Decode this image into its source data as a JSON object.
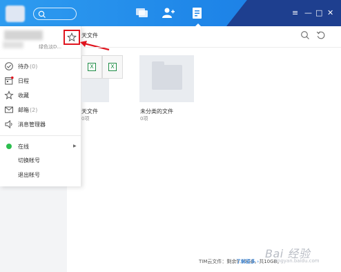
{
  "titlebar": {
    "nav": [
      "message-icon",
      "contacts-icon",
      "files-icon"
    ],
    "active_nav": "files-icon",
    "controls": {
      "menu": "≡",
      "minimize": "—",
      "maximize": "□",
      "close": "✕"
    },
    "colors": {
      "bar": "#1f86e8",
      "dark": "#1e3f8f"
    }
  },
  "profile": {
    "signature": "绿色淡D..."
  },
  "menu": {
    "items": [
      {
        "label": "待办",
        "count": "(0)",
        "icon": "check-circle-icon"
      },
      {
        "label": "日程",
        "count": "",
        "icon": "calendar-icon"
      },
      {
        "label": "收藏",
        "count": "",
        "icon": "star-icon"
      },
      {
        "label": "邮箱",
        "count": "(2)",
        "icon": "mail-icon"
      },
      {
        "label": "消息管理器",
        "count": "",
        "icon": "speaker-icon"
      }
    ],
    "status": {
      "label": "在线",
      "color": "#2cbe4e"
    },
    "switch_account": "切换帐号",
    "logout": "退出帐号"
  },
  "main": {
    "title": "天文件",
    "folders": [
      {
        "name": "天文件",
        "count": "0项"
      },
      {
        "name": "未分类的文件",
        "count": "0项"
      }
    ]
  },
  "footer": {
    "storage": "TIM云文件：剩余9.99GB，共10GB。",
    "learn_more": "了解更多 ›"
  },
  "watermark": {
    "main": "Bai 经验",
    "sub": "jingyan.baidu.com"
  }
}
